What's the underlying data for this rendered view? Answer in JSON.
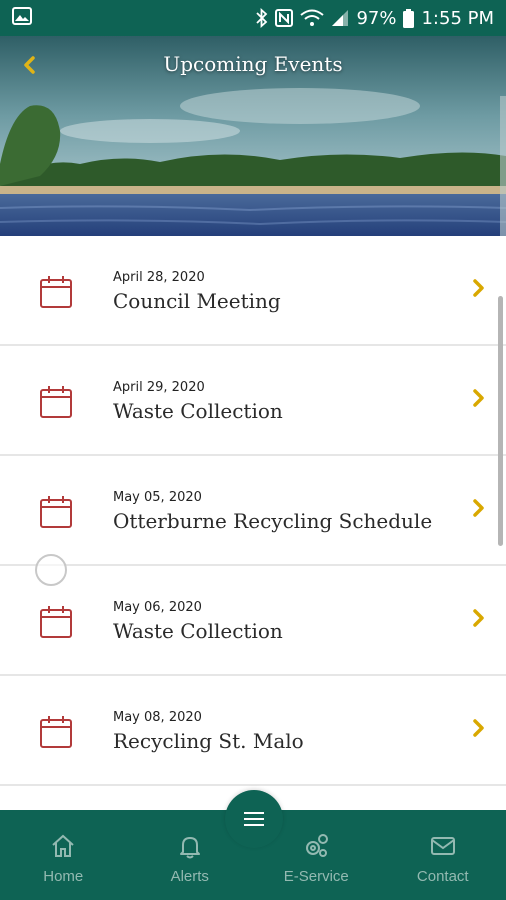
{
  "status_bar": {
    "battery": "97%",
    "time": "1:55 PM"
  },
  "header": {
    "title": "Upcoming Events"
  },
  "events": [
    {
      "date": "April 28, 2020",
      "title": "Council Meeting"
    },
    {
      "date": "April 29, 2020",
      "title": "Waste Collection"
    },
    {
      "date": "May 05, 2020",
      "title": "Otterburne Recycling Schedule"
    },
    {
      "date": "May 06, 2020",
      "title": "Waste Collection"
    },
    {
      "date": "May 08, 2020",
      "title": "Recycling St. Malo"
    }
  ],
  "bottom_nav": {
    "items": [
      {
        "label": "Home",
        "icon": "home-icon"
      },
      {
        "label": "Alerts",
        "icon": "bell-icon"
      },
      {
        "label": "E-Service",
        "icon": "gears-icon"
      },
      {
        "label": "Contact",
        "icon": "envelope-icon"
      }
    ],
    "menu_icon": "hamburger-menu-icon"
  },
  "colors": {
    "brand_green": "#0e6354",
    "accent_gold": "#d9a800",
    "calendar_red": "#b23a3a",
    "nav_label": "#93b9b1"
  }
}
